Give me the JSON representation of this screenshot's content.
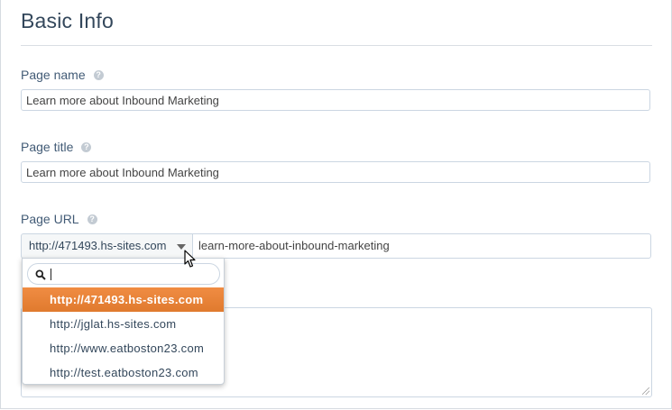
{
  "section": {
    "title": "Basic Info"
  },
  "page_name": {
    "label": "Page name",
    "value": "Learn more about Inbound Marketing"
  },
  "page_title": {
    "label": "Page title",
    "value": "Learn more about Inbound Marketing"
  },
  "page_url": {
    "label": "Page URL",
    "selected_domain": "http://471493.hs-sites.com",
    "slug": "learn-more-about-inbound-marketing"
  },
  "help_glyph": "?",
  "domain_dropdown": {
    "search_value": "",
    "options": [
      {
        "label": "http://471493.hs-sites.com",
        "active": true
      },
      {
        "label": "http://jglat.hs-sites.com",
        "active": false
      },
      {
        "label": "http://www.eatboston23.com",
        "active": false
      },
      {
        "label": "http://test.eatboston23.com",
        "active": false
      }
    ]
  },
  "colors": {
    "accent": "#e98338",
    "text": "#33475b",
    "border": "#cbd6e2"
  },
  "icons": [
    "help-icon",
    "caret-down-icon",
    "search-icon",
    "resize-grip-icon",
    "mouse-pointer-icon"
  ]
}
